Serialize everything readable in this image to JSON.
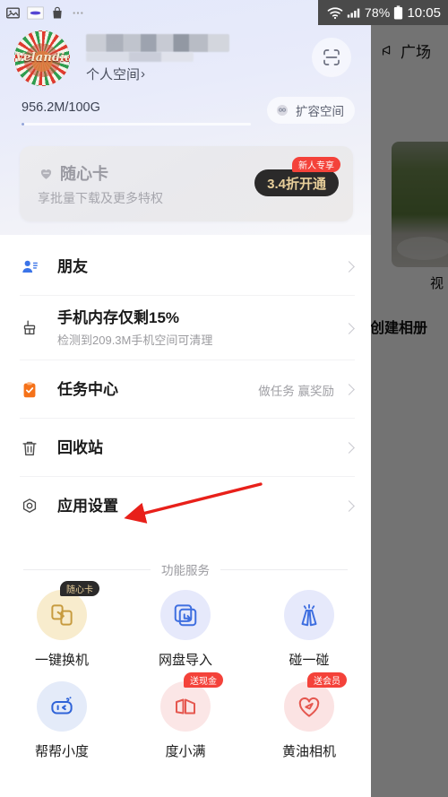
{
  "status_bar": {
    "left_icons": [
      "image-icon",
      "pill-icon",
      "shopping-bag-icon",
      "more-ellipsis-icon"
    ],
    "wifi_icon": "wifi-icon",
    "signal_icon": "signal-bars-icon",
    "battery_percent": "78%",
    "battery_icon": "battery-icon",
    "clock": "10:05"
  },
  "background_app": {
    "plaza_label": "广场",
    "plaza_icon": "megaphone-icon",
    "photo_caption": "视",
    "create_album_label": "创建相册"
  },
  "profile": {
    "avatar_word": "Velandia",
    "avatar_name": "user-avatar",
    "username_masked": "",
    "personal_space_label": "个人空间",
    "personal_space_arrow": "›",
    "scan_icon": "scan-code-icon",
    "storage_used_total": "956.2M/100G",
    "storage_fill_percent": 1,
    "expand_label": "扩容空间",
    "expand_icon": "expand-space-icon"
  },
  "promo": {
    "title": "随心卡",
    "title_icon": "heart-card-icon",
    "subtitle": "享批量下载及更多特权",
    "button_label": "3.4折开通",
    "badge_label": "新人专享",
    "badge_color": "#f4423a",
    "button_bg": "#2b2a2a",
    "button_text_color": "#e8cf9a"
  },
  "menu": {
    "items": [
      {
        "label": "朋友",
        "sub": "",
        "hint": "",
        "icon": "friends-person-icon",
        "icon_color": "#3b74e8"
      },
      {
        "label": "手机内存仅剩15%",
        "sub": "检测到209.3M手机空间可清理",
        "hint": "",
        "icon": "broom-clean-icon",
        "icon_color": "#4a4a4a"
      },
      {
        "label": "任务中心",
        "sub": "",
        "hint": "做任务 赢奖励",
        "icon": "task-clipboard-icon",
        "icon_color": "#f5721a"
      },
      {
        "label": "回收站",
        "sub": "",
        "hint": "",
        "icon": "trash-recycle-icon",
        "icon_color": "#4a4a4a"
      },
      {
        "label": "应用设置",
        "sub": "",
        "hint": "",
        "icon": "settings-gear-icon",
        "icon_color": "#4a4a4a"
      }
    ]
  },
  "services": {
    "section_title": "功能服务",
    "items": [
      {
        "label": "一键换机",
        "icon": "phone-transfer-icon",
        "circle_color": "#f8eccd",
        "icon_color": "#c79b3f",
        "badge": "随心卡",
        "badge_style": "dark"
      },
      {
        "label": "网盘导入",
        "icon": "cloud-import-icon",
        "circle_color": "#e6e9fb",
        "icon_color": "#3f6fe0",
        "badge": "",
        "badge_style": ""
      },
      {
        "label": "碰一碰",
        "icon": "tap-phones-icon",
        "circle_color": "#e6e9fb",
        "icon_color": "#3f6fe0",
        "badge": "",
        "badge_style": ""
      },
      {
        "label": "帮帮小度",
        "icon": "assistant-robot-icon",
        "circle_color": "#e4ebf9",
        "icon_color": "#2f63d8",
        "badge": "",
        "badge_style": ""
      },
      {
        "label": "度小满",
        "icon": "finance-wallet-icon",
        "circle_color": "#fbe6e6",
        "icon_color": "#e5574f",
        "badge": "送现金",
        "badge_style": "red"
      },
      {
        "label": "黄油相机",
        "icon": "butter-camera-heart-icon",
        "circle_color": "#fbe3e3",
        "icon_color": "#e5574f",
        "badge": "送会员",
        "badge_style": "red"
      }
    ]
  },
  "annotation": {
    "arrow_color": "#e8201a",
    "arrow_name": "red-annotation-arrow",
    "points_at": "应用设置"
  }
}
